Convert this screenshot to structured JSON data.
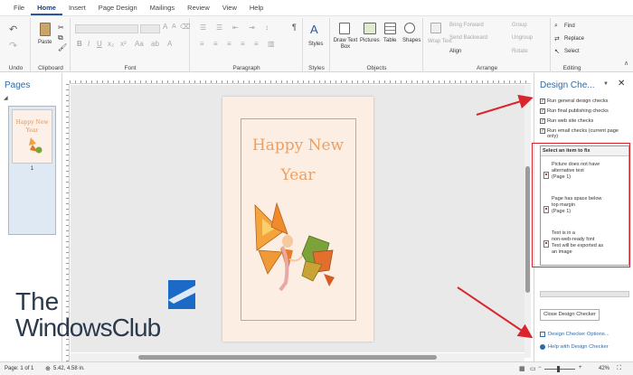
{
  "menu": {
    "tabs": [
      "File",
      "Home",
      "Insert",
      "Page Design",
      "Mailings",
      "Review",
      "View",
      "Help"
    ],
    "active": "Home"
  },
  "ribbon": {
    "groups": {
      "undo": "Undo",
      "clipboard": "Clipboard",
      "font": "Font",
      "paragraph": "Paragraph",
      "styles": "Styles",
      "objects": "Objects",
      "arrange": "Arrange",
      "editing": "Editing"
    },
    "paste": "Paste",
    "styles_btn": "Styles",
    "draw_text_box": "Draw Text Box",
    "pictures": "Pictures",
    "table": "Table",
    "shapes": "Shapes",
    "wrap_text": "Wrap Text",
    "bring_forward": "Bring Forward",
    "send_backward": "Send Backward",
    "align": "Align",
    "group": "Group",
    "ungroup": "Ungroup",
    "rotate": "Rotate",
    "find": "Find",
    "replace": "Replace",
    "select": "Select"
  },
  "pages_pane": {
    "title": "Pages",
    "thumb_line1": "Happy New",
    "thumb_line2": "Year",
    "page_number": "1"
  },
  "document": {
    "headline_line1": "Happy New",
    "headline_line2": "Year"
  },
  "watermark": {
    "line1": "The",
    "line2": "WindowsClub"
  },
  "design_checker": {
    "title": "Design Che...",
    "options": [
      {
        "label": "Run general design checks",
        "checked": true
      },
      {
        "label": "Run final publishing checks",
        "checked": true
      },
      {
        "label": "Run web site checks",
        "checked": true
      },
      {
        "label": "Run email checks (current page only)",
        "checked": true
      }
    ],
    "list_header": "Select an item to fix",
    "items": [
      {
        "l1": "Picture does not have",
        "l2": "alternative text",
        "l3": "(Page 1)"
      },
      {
        "l1": "Page has space below",
        "l2": "top margin",
        "l3": "(Page 1)"
      },
      {
        "l1": "Text is in a",
        "l2": "non-web-ready font",
        "l3": "Text will be exported as",
        "l4": "an image"
      }
    ],
    "close_button": "Close Design Checker",
    "options_link": "Design Checker Options...",
    "help_link": "Help with Design Checker"
  },
  "status": {
    "page": "Page: 1 of 1",
    "position": "5.42, 4.58 in.",
    "zoom": "42%"
  },
  "colors": {
    "accent": "#2b579a",
    "pane_title": "#2e6aa8",
    "annotation": "#d9262e",
    "headline": "#eda061"
  }
}
